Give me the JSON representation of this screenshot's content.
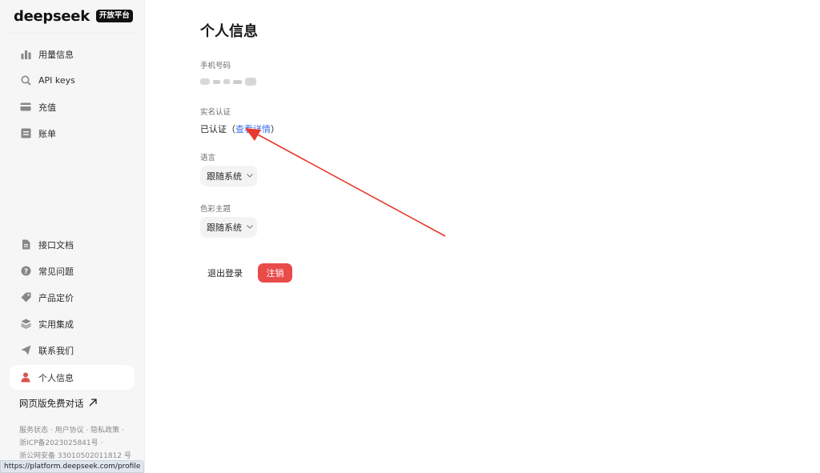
{
  "brand": {
    "name": "deepseek",
    "badge": "开放平台"
  },
  "sidebar": {
    "top_items": [
      {
        "label": "用量信息",
        "icon": "bar-chart-icon"
      },
      {
        "label": "API keys",
        "icon": "search-icon"
      },
      {
        "label": "充值",
        "icon": "card-icon"
      },
      {
        "label": "账单",
        "icon": "bill-icon"
      }
    ],
    "bottom_items": [
      {
        "label": "接口文档",
        "icon": "document-icon"
      },
      {
        "label": "常见问题",
        "icon": "question-icon"
      },
      {
        "label": "产品定价",
        "icon": "tag-icon"
      },
      {
        "label": "实用集成",
        "icon": "layers-icon"
      },
      {
        "label": "联系我们",
        "icon": "send-icon"
      },
      {
        "label": "个人信息",
        "icon": "user-icon",
        "active": true
      }
    ],
    "web_chat": "网页版免费对话",
    "footer": {
      "line1": "服务状态 · 用户协议 · 隐私政策 ·",
      "line2": "浙ICP备2023025841号 ·",
      "line3": "浙公网安备 33010502011812 号"
    }
  },
  "status_url": "https://platform.deepseek.com/profile",
  "main": {
    "title": "个人信息",
    "phone_label": "手机号码",
    "realname_label": "实名认证",
    "realname_value_prefix": "已认证（",
    "realname_link": "查看详情",
    "realname_value_suffix": "）",
    "language_label": "语言",
    "language_value": "跟随系统",
    "theme_label": "色彩主题",
    "theme_value": "跟随系统",
    "logout": "退出登录",
    "cancel_account": "注销"
  },
  "colors": {
    "accent_link": "#3c6df0",
    "danger": "#e94b4b",
    "active_icon": "#d9534f",
    "annotation_arrow": "#e8372c"
  }
}
